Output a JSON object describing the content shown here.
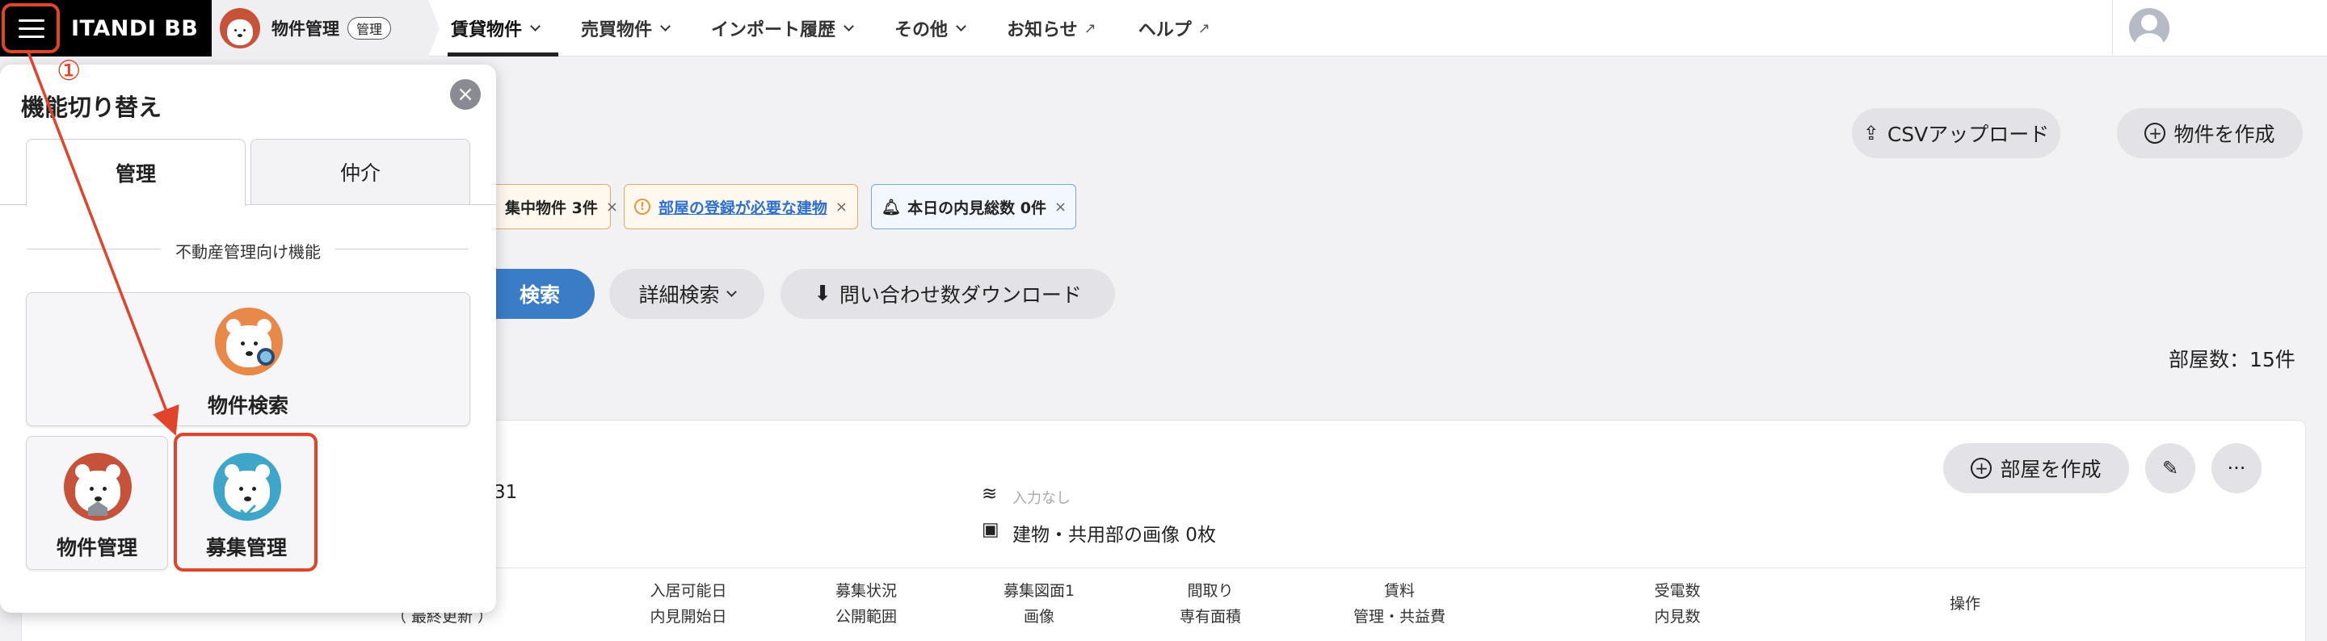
{
  "header": {
    "brand": "ITANDI BB",
    "product_name": "物件管理",
    "product_badge": "管理",
    "nav": [
      {
        "label": "賃貸物件",
        "has_dropdown": true,
        "active": true
      },
      {
        "label": "売買物件",
        "has_dropdown": true
      },
      {
        "label": "インポート履歴",
        "has_dropdown": true
      },
      {
        "label": "その他",
        "has_dropdown": true
      },
      {
        "label": "お知らせ",
        "external": true
      },
      {
        "label": "ヘルプ",
        "external": true
      }
    ]
  },
  "main": {
    "csv_upload_label": "CSVアップロード",
    "create_property_label": "物件を作成",
    "chips": [
      {
        "label": "集中物件 3件",
        "close": "×"
      },
      {
        "label": "部屋の登録が必要な建物",
        "close": "×"
      },
      {
        "label": "本日の内見総数 0件",
        "close": "×"
      }
    ],
    "search_label": "検索",
    "detail_search_label": "詳細検索",
    "inquiry_download_label": "問い合わせ数ダウンロード",
    "room_count": "部屋数：15件",
    "card": {
      "partial_number": "31",
      "no_input": "入力なし",
      "image_count": "建物・共用部の画像 0枚",
      "create_room_label": "部屋を作成",
      "more_label": "···"
    },
    "table_headers": [
      {
        "top": "",
        "bottom": "（ 最終更新 ）"
      },
      {
        "top": "入居可能日",
        "bottom": "内見開始日"
      },
      {
        "top": "募集状況",
        "bottom": "公開範囲"
      },
      {
        "top": "募集図面1",
        "bottom": "画像"
      },
      {
        "top": "間取り",
        "bottom": "専有面積"
      },
      {
        "top": "賃料",
        "bottom": "管理・共益費"
      },
      {
        "top": "受電数",
        "bottom": "内見数"
      },
      {
        "top": "操作",
        "bottom": ""
      }
    ]
  },
  "panel": {
    "title": "機能切り替え",
    "close": "×",
    "tabs": [
      {
        "label": "管理",
        "active": true
      },
      {
        "label": "仲介",
        "active": false
      }
    ],
    "section_label": "不動産管理向け機能",
    "tiles": [
      {
        "label": "物件検索",
        "color": "#e8894a"
      },
      {
        "label": "物件管理",
        "color": "#c7523a"
      },
      {
        "label": "募集管理",
        "color": "#3fa6c9"
      }
    ]
  },
  "annotation": {
    "number": "①",
    "color": "#e0442a"
  }
}
